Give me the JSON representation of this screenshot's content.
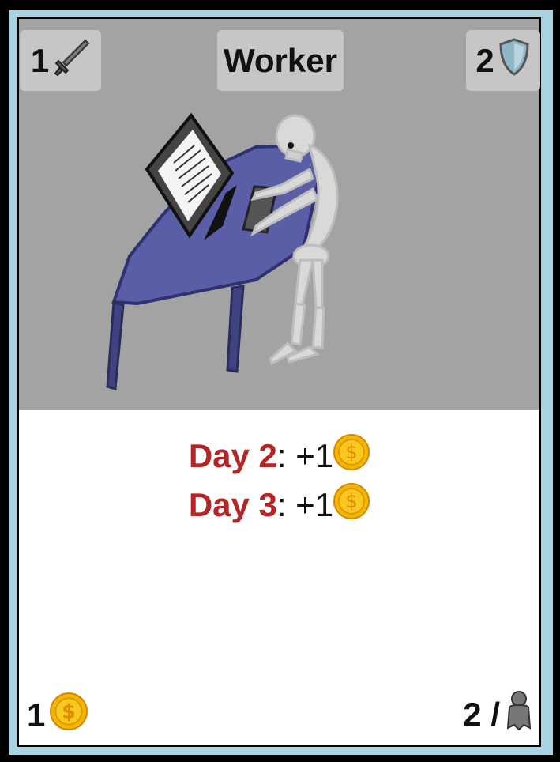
{
  "card": {
    "title": "Worker",
    "attack": "1",
    "defense": "2",
    "cost": "1",
    "population": "2 /",
    "abilities": [
      {
        "day": "Day 2",
        "text": ": +1"
      },
      {
        "day": "Day 3",
        "text": ": +1"
      }
    ],
    "icons": {
      "attack": "sword-icon",
      "defense": "shield-icon",
      "coin": "coin-icon",
      "population": "person-icon"
    },
    "colors": {
      "frame": "#a8d3e2",
      "art_background": "#a3a3a3",
      "day_label": "#b52525",
      "coin": "#f2b705",
      "table": "#5a5ea6"
    }
  }
}
